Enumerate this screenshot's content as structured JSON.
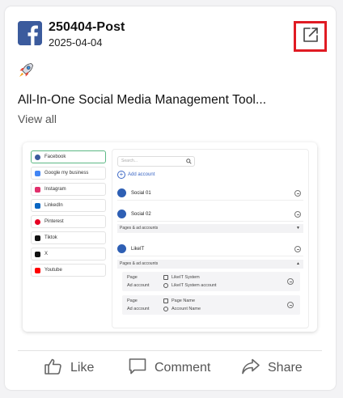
{
  "post": {
    "title": "250404-Post",
    "date": "2025-04-04",
    "text": "All-In-One Social Media Management Tool...",
    "view_all": "View all"
  },
  "icons": {
    "network": "facebook-icon",
    "open": "external-link-icon",
    "emoji": "rocket-icon"
  },
  "preview": {
    "networks": [
      {
        "label": "Facebook",
        "color": "#3b5b9d"
      },
      {
        "label": "Google my business",
        "color": "#4285f4"
      },
      {
        "label": "Instagram",
        "color": "#e1306c"
      },
      {
        "label": "LinkedIn",
        "color": "#0a66c2"
      },
      {
        "label": "Pinterest",
        "color": "#e60023"
      },
      {
        "label": "Tiktok",
        "color": "#111111"
      },
      {
        "label": "X",
        "color": "#111111"
      },
      {
        "label": "Youtube",
        "color": "#ff0000"
      }
    ],
    "search_placeholder": "Search...",
    "add_account": "Add account",
    "accounts": [
      {
        "name": "Social 01"
      },
      {
        "name": "Social 02"
      },
      {
        "name": "LikeIT"
      }
    ],
    "pages_label_1": "Pages & ad accounts",
    "pages_label_2": "Pages & ad accounts",
    "page_blocks": [
      {
        "page_key": "Page",
        "page_val": "LikeIT System",
        "ad_key": "Ad account",
        "ad_val": "LikeIT System account"
      },
      {
        "page_key": "Page",
        "page_val": "Page Name",
        "ad_key": "Ad account",
        "ad_val": "Account Name"
      }
    ]
  },
  "actions": {
    "like": "Like",
    "comment": "Comment",
    "share": "Share"
  },
  "colors": {
    "facebook_blue": "#3b5b9d",
    "highlight_red": "#e01b23",
    "active_green": "#5cb885"
  }
}
